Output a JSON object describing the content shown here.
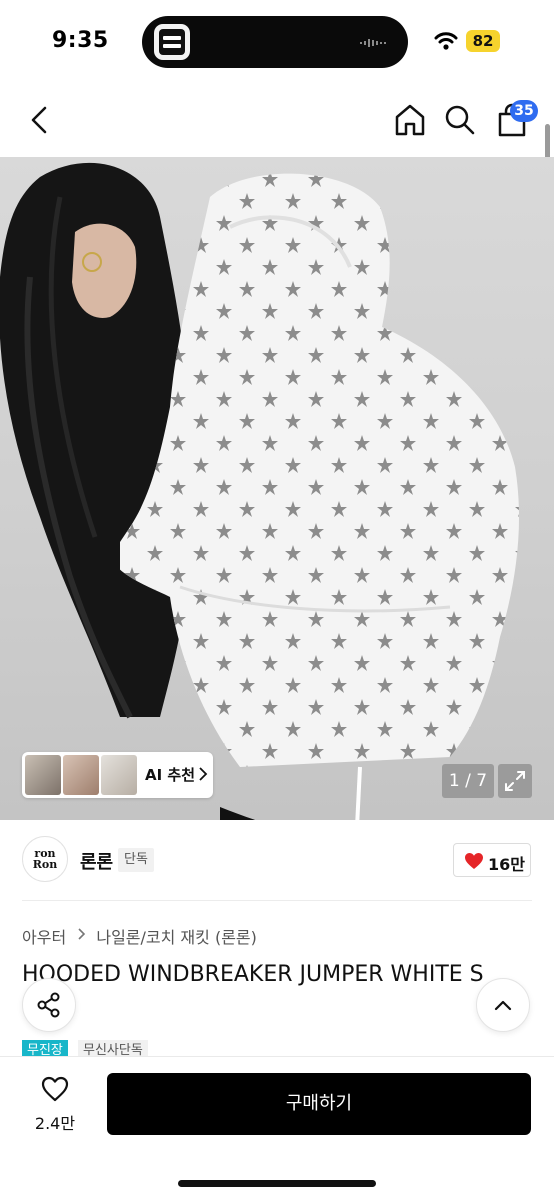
{
  "status_bar": {
    "time": "9:35",
    "battery": "82"
  },
  "nav": {
    "cart_count": "35",
    "icons": [
      "back-arrow-icon",
      "home-icon",
      "search-icon",
      "cart-icon"
    ]
  },
  "gallery": {
    "ai_label": "AI 추천",
    "page_indicator": "1 / 7"
  },
  "brand": {
    "logo_line1": "ron",
    "logo_line2": "Ron",
    "name": "론론",
    "tag": "단독",
    "likes": "16만"
  },
  "product": {
    "breadcrumb": [
      "아우터",
      "나일론/코치 재킷 (론론)"
    ],
    "title": "HOODED WINDBREAKER JUMPER WHITE S",
    "tags": [
      "무진장",
      "무신사단독"
    ]
  },
  "bottom": {
    "wish_count": "2.4만",
    "buy_label": "구매하기"
  },
  "colors": {
    "accent_blue": "#2f6cf0",
    "tag_teal": "#18b6c9",
    "heart_red": "#e52528",
    "battery_yellow": "#f6d32d"
  }
}
